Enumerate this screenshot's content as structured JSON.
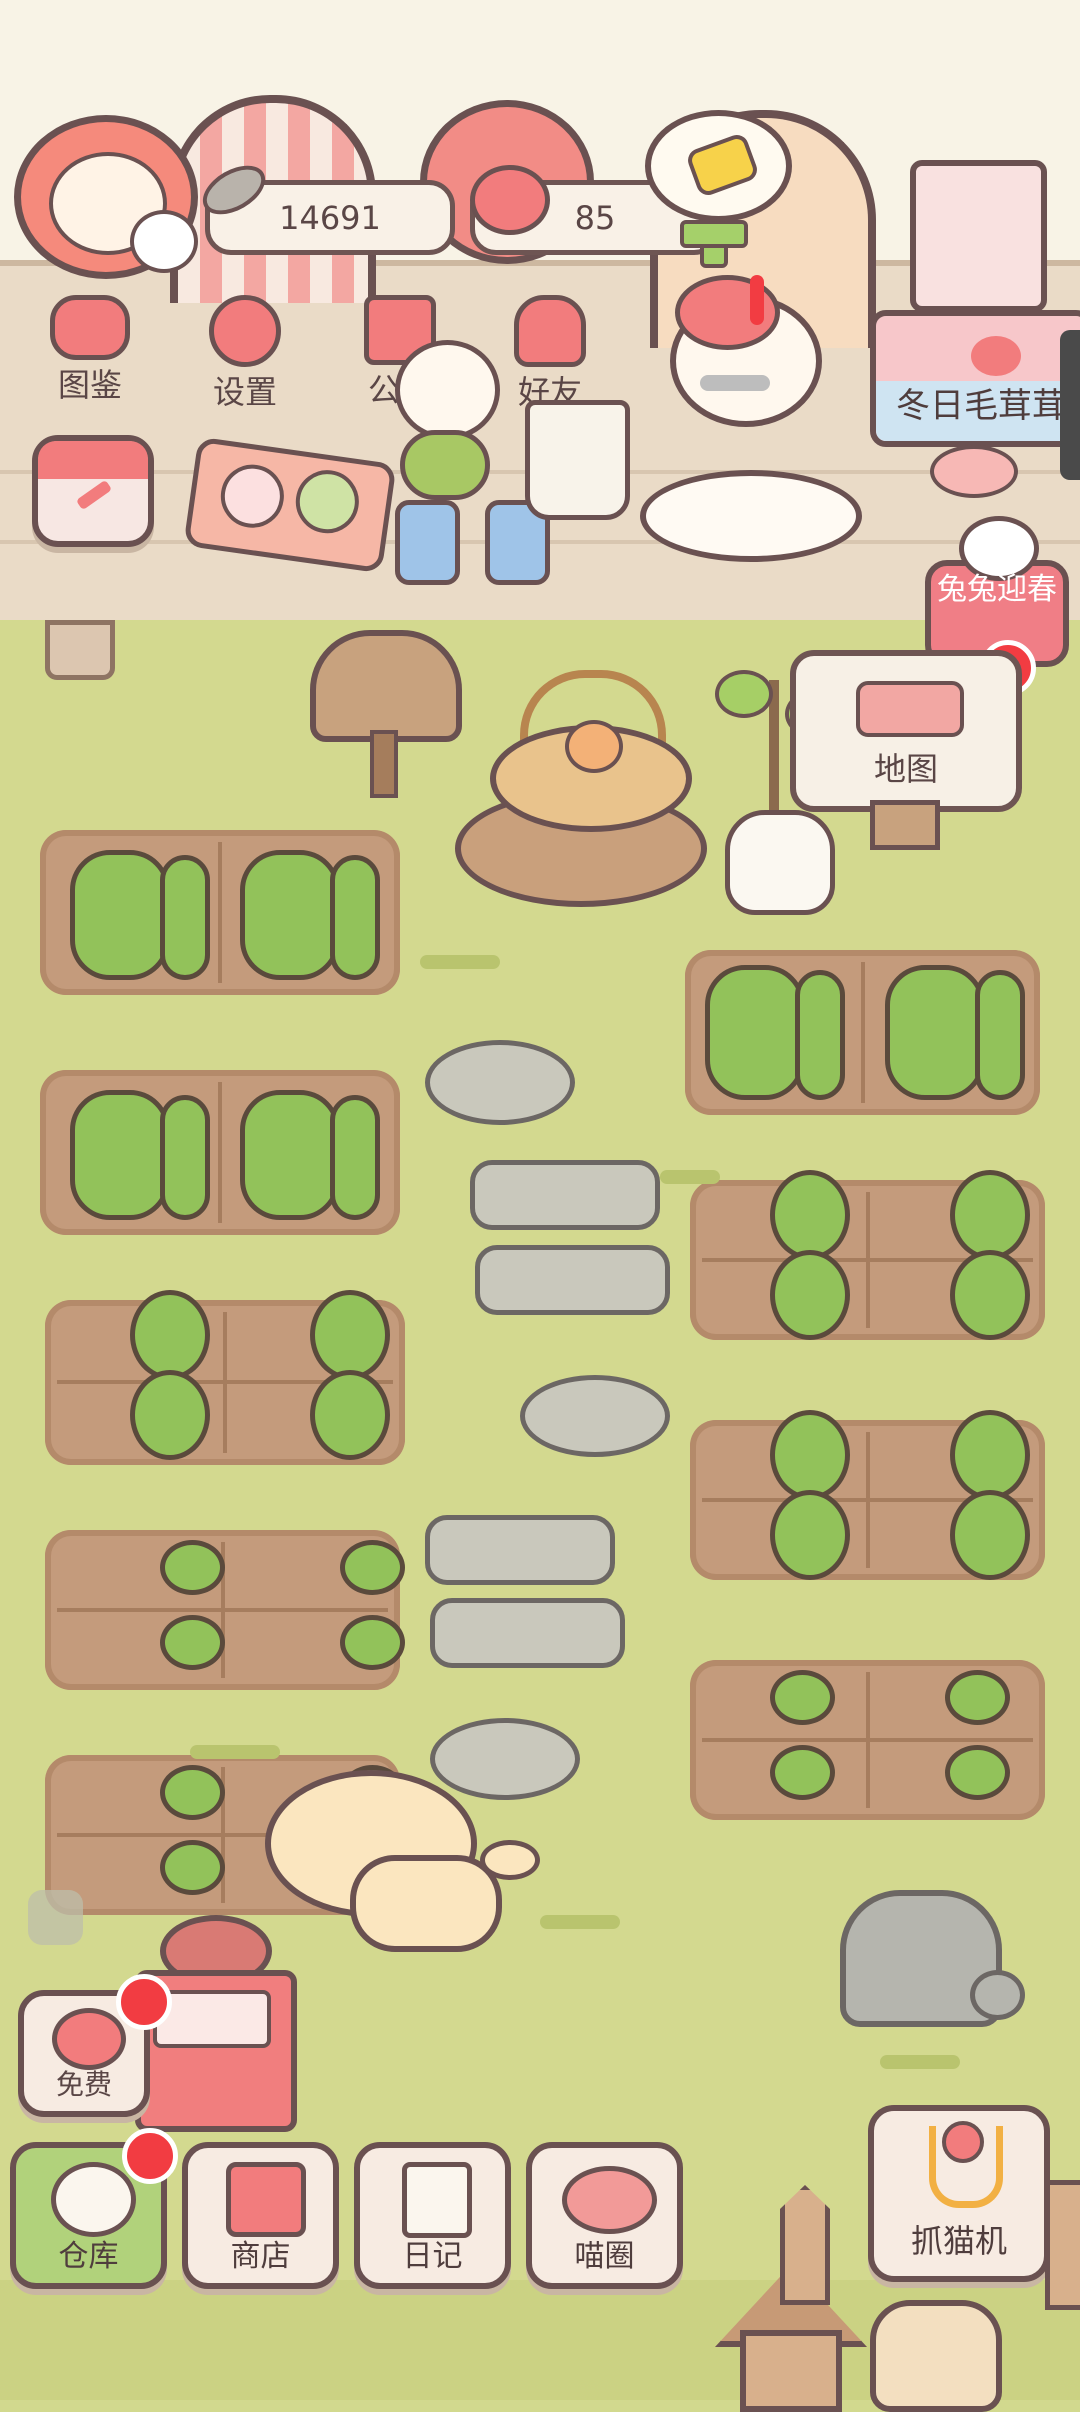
{
  "hud": {
    "coins": "14691",
    "hearts": "85"
  },
  "top_menu": [
    {
      "label": "图鉴",
      "icon": "cat-face-icon"
    },
    {
      "label": "设置",
      "icon": "gear-icon"
    },
    {
      "label": "公告",
      "icon": "gift-icon"
    },
    {
      "label": "好友",
      "icon": "friends-icon"
    }
  ],
  "event_banner": {
    "label": "冬日毛茸茸"
  },
  "rabbit_event": {
    "label": "兔兔迎春"
  },
  "map_sign": {
    "label": "地图"
  },
  "free_button": {
    "label": "免费"
  },
  "bottom_nav": [
    {
      "label": "仓库",
      "icon": "warehouse-icon"
    },
    {
      "label": "商店",
      "icon": "shop-icon"
    },
    {
      "label": "日记",
      "icon": "diary-icon"
    },
    {
      "label": "喵圈",
      "icon": "cat-planet-icon"
    }
  ],
  "claw_machine": {
    "label": "抓猫机"
  },
  "colors": {
    "accent": "#f27c7d",
    "outline": "#6a5151",
    "grass": "#d3d98f",
    "soil": "#c49b7c",
    "badge": "#f23c42"
  }
}
